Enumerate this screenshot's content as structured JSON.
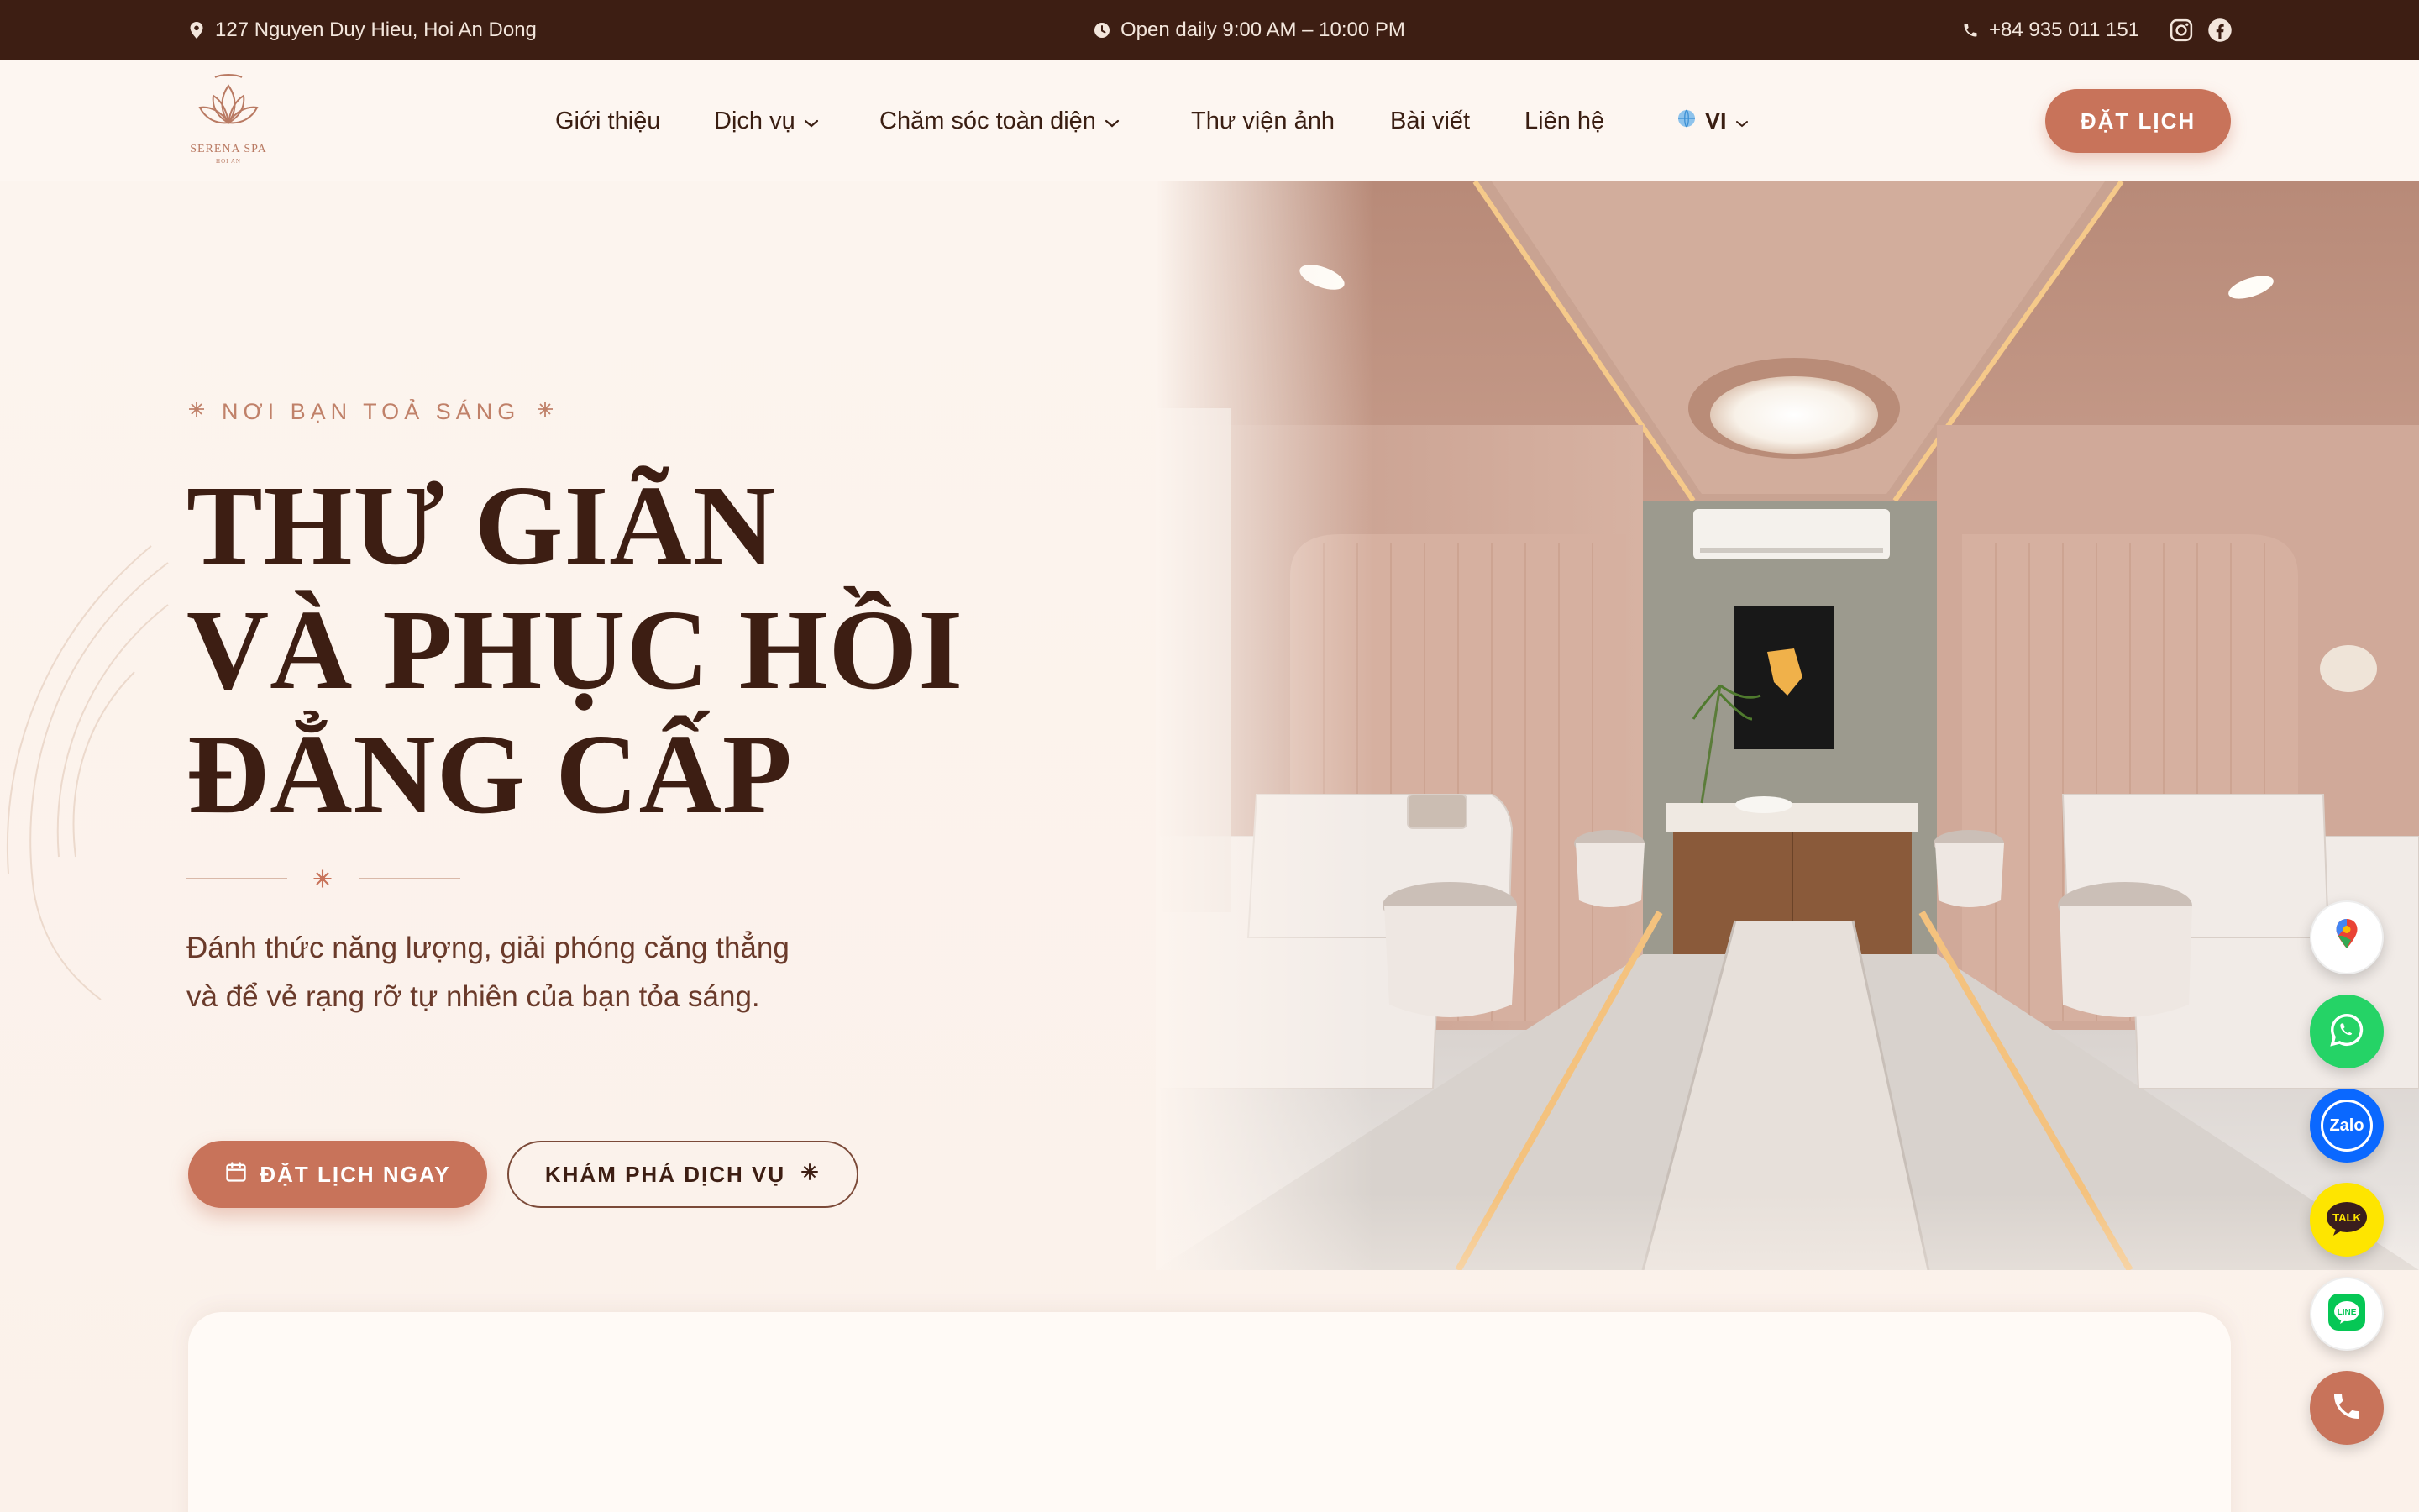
{
  "topbar": {
    "address": "127 Nguyen Duy Hieu, Hoi An Dong",
    "hours": "Open daily 9:00 AM – 10:00 PM",
    "phone": "+84 935 011 151",
    "icons": [
      "map-pin-icon",
      "clock-icon",
      "phone-icon",
      "instagram-icon",
      "facebook-icon"
    ]
  },
  "header": {
    "logo_text": "SERENA SPA",
    "logo_sub": "HOI AN",
    "nav": [
      {
        "label": "Giới thiệu",
        "has_dropdown": false
      },
      {
        "label": "Dịch vụ",
        "has_dropdown": true
      },
      {
        "label": "Chăm sóc toàn diện",
        "has_dropdown": true
      },
      {
        "label": "Thư viện ảnh",
        "has_dropdown": false
      },
      {
        "label": "Bài viết",
        "has_dropdown": false
      },
      {
        "label": "Liên hệ",
        "has_dropdown": false
      }
    ],
    "language": "VI",
    "book_button": "ĐẶT LỊCH"
  },
  "hero": {
    "eyebrow": "NƠI BẠN TOẢ SÁNG",
    "headline": [
      "THƯ GIÃN",
      "VÀ PHỤC HỒI",
      "ĐẲNG CẤP"
    ],
    "description": "Đánh thức năng lượng, giải phóng căng thẳng và để vẻ rạng rỡ tự nhiên của bạn tỏa sáng.",
    "primary_button": "ĐẶT LỊCH NGAY",
    "secondary_button": "KHÁM PHÁ DỊCH VỤ"
  },
  "floating_contacts": [
    {
      "name": "Google Maps",
      "color": "#ffffff"
    },
    {
      "name": "WhatsApp",
      "color": "#25d366"
    },
    {
      "name": "Zalo",
      "color": "#0a68ff"
    },
    {
      "name": "TALK",
      "color": "#fee500"
    },
    {
      "name": "LINE",
      "color": "#06c755"
    },
    {
      "name": "Call",
      "color": "#c8735a"
    }
  ],
  "colors": {
    "brand": "#c8735a",
    "dark": "#3d1e13",
    "background": "#fcf5ef"
  }
}
